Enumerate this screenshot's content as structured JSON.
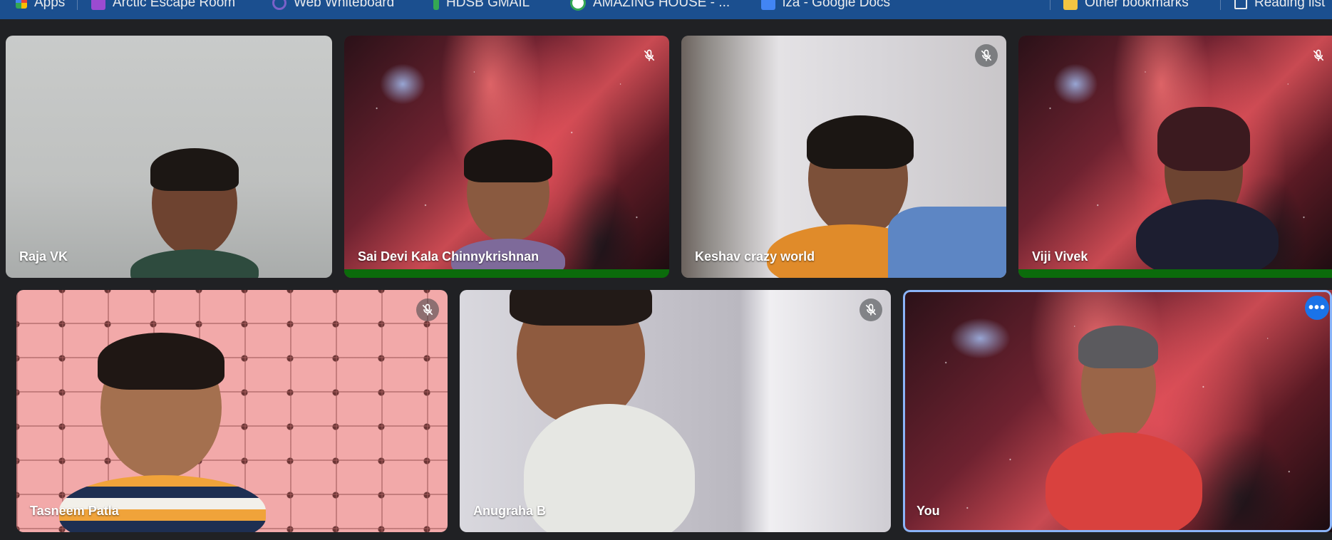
{
  "bookmarks": {
    "items": [
      {
        "label": "Apps",
        "icon": "apps-grid-icon"
      },
      {
        "label": "Arctic Escape Room",
        "icon": "purple-app-icon"
      },
      {
        "label": "Web Whiteboard",
        "icon": "whiteboard-icon"
      },
      {
        "label": "HDSB GMAIL",
        "icon": "hdsb-icon"
      },
      {
        "label": "AMAZING HOUSE - ...",
        "icon": "green-circle-icon"
      },
      {
        "label": "iza - Google Docs",
        "icon": "google-docs-icon"
      },
      {
        "label": "Other bookmarks",
        "icon": "folder-icon"
      },
      {
        "label": "Reading list",
        "icon": "reading-list-icon"
      }
    ]
  },
  "participants": [
    {
      "name": "Raja VK",
      "muted": false,
      "speaking": false
    },
    {
      "name": "Sai Devi Kala Chinnykrishnan",
      "muted": true,
      "speaking": true
    },
    {
      "name": "Keshav crazy world",
      "muted": true,
      "speaking": false
    },
    {
      "name": "Viji Vivek",
      "muted": true,
      "speaking": true
    },
    {
      "name": "Tasneem Patla",
      "muted": true,
      "speaking": false
    },
    {
      "name": "Anugraha B",
      "muted": true,
      "speaking": false
    },
    {
      "name": "You",
      "muted": false,
      "speaking": false,
      "self": true
    }
  ],
  "colors": {
    "background": "#202124",
    "bookmarks_bar": "#1b4f8f",
    "speaking_bar": "#0b6b0b",
    "self_border": "#8ab4f8",
    "more_button": "#1a73e8"
  }
}
